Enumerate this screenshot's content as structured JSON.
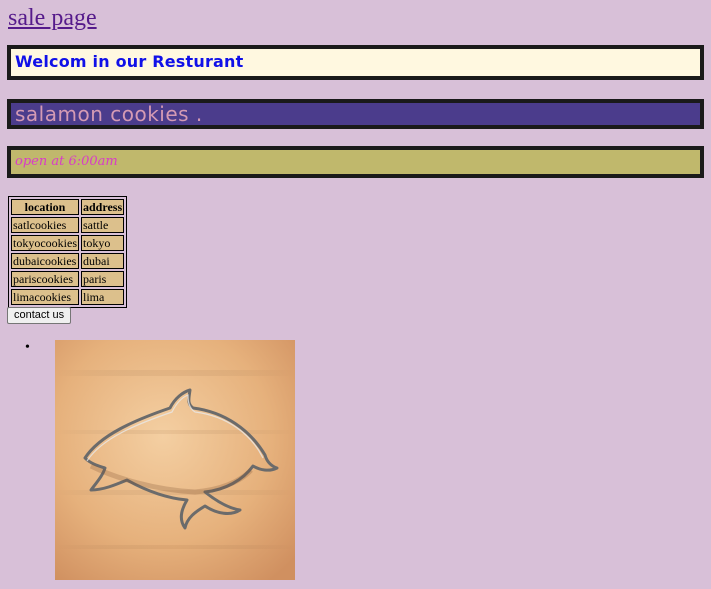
{
  "nav": {
    "link_label": "sale page"
  },
  "banners": {
    "welcome": "Welcom in our Resturant",
    "name": "salamon cookies .",
    "hours": "open at 6:00am"
  },
  "locations_table": {
    "headers": [
      "location",
      "address"
    ],
    "rows": [
      [
        "satlcookies",
        "sattle"
      ],
      [
        "tokyocookies",
        "tokyo"
      ],
      [
        "dubaicookies",
        "dubai"
      ],
      [
        "pariscookies",
        "paris"
      ],
      [
        "limacookies",
        "lima"
      ]
    ]
  },
  "contact_button": {
    "label": "contact us"
  },
  "list": {
    "bullet": "•"
  },
  "image": {
    "subject": "dolphin-shaped cookie cutter on wooden surface"
  },
  "colors": {
    "page_background": "#d8c0d8",
    "welcome_background": "#fff8e0",
    "welcome_text": "#1010e8",
    "name_background": "#4b3c8c",
    "name_text": "#d49ab4",
    "hours_background": "#c0b86c",
    "hours_text": "#d83cc8",
    "table_cell": "#dcc08c",
    "link": "#551a8b"
  }
}
